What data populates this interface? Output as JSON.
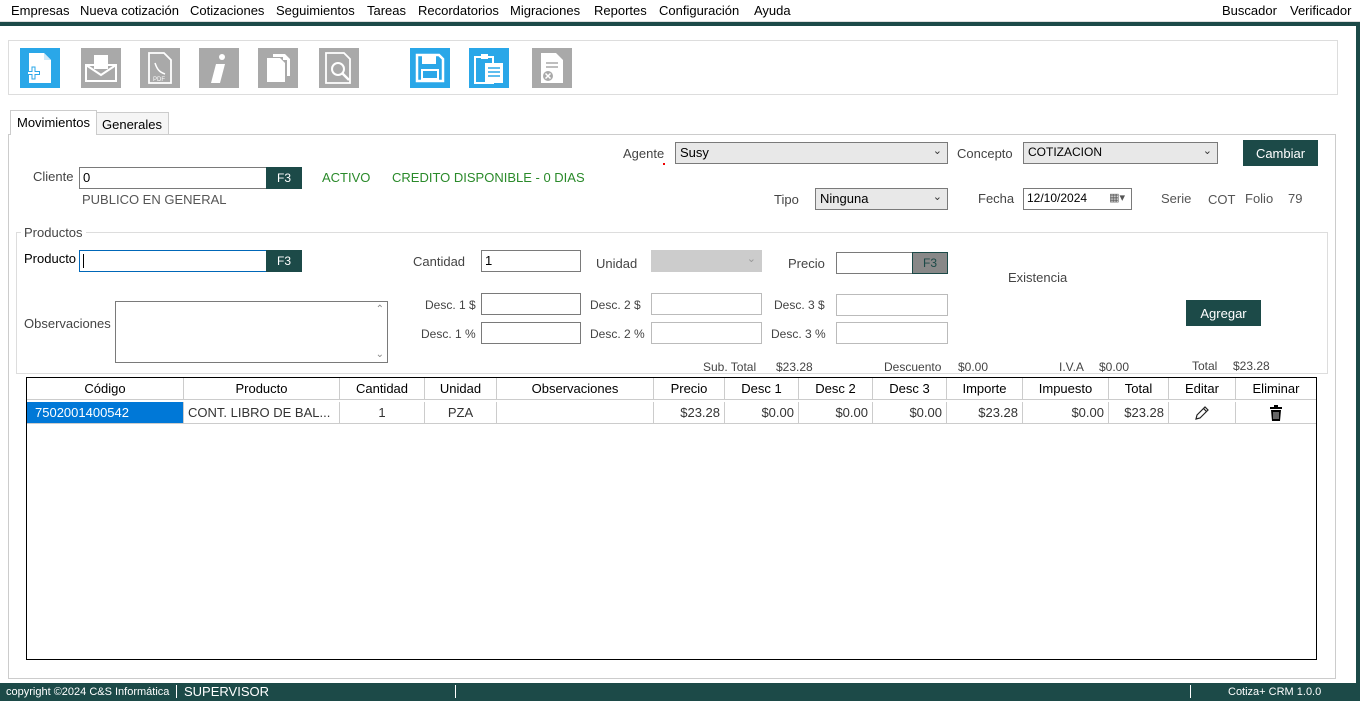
{
  "menu": [
    "Empresas",
    "Nueva cotización",
    "Cotizaciones",
    "Seguimientos",
    "Tareas",
    "Recordatorios",
    "Migraciones",
    "Reportes",
    "Configuración",
    "Ayuda"
  ],
  "menu_right": [
    "Buscador",
    "Verificador"
  ],
  "tabs": [
    "Movimientos",
    "Generales"
  ],
  "cliente": {
    "label": "Cliente",
    "value": "0",
    "f3": "F3",
    "nombre": "PUBLICO EN GENERAL",
    "estado": "ACTIVO",
    "credito": "CREDITO DISPONIBLE - 0 DIAS"
  },
  "agente": {
    "label": "Agente",
    "value": "Susy"
  },
  "concepto": {
    "label": "Concepto",
    "value": "COTIZACION"
  },
  "cambiar": "Cambiar",
  "tipo": {
    "label": "Tipo",
    "value": "Ninguna"
  },
  "fecha": {
    "label": "Fecha",
    "value": "12/10/2024"
  },
  "serie": {
    "label": "Serie",
    "value": "COT"
  },
  "folio": {
    "label": "Folio",
    "value": "79"
  },
  "productos": {
    "legend": "Productos",
    "producto_label": "Producto",
    "producto_value": "",
    "f3": "F3",
    "cantidad_label": "Cantidad",
    "cantidad_value": "1",
    "unidad_label": "Unidad",
    "precio_label": "Precio",
    "precio_f3": "F3",
    "existencia_label": "Existencia",
    "observaciones_label": "Observaciones",
    "desc1d": "Desc. 1 $",
    "desc2d": "Desc. 2 $",
    "desc3d": "Desc. 3 $",
    "desc1p": "Desc. 1 %",
    "desc2p": "Desc. 2 %",
    "desc3p": "Desc. 3 %",
    "agregar": "Agregar"
  },
  "totales": {
    "subtotal_label": "Sub. Total",
    "subtotal": "$23.28",
    "descuento_label": "Descuento",
    "descuento": "$0.00",
    "iva_label": "I.V.A",
    "iva": "$0.00",
    "total_label": "Total",
    "total": "$23.28"
  },
  "grid": {
    "headers": [
      "Código",
      "Producto",
      "Cantidad",
      "Unidad",
      "Observaciones",
      "Precio",
      "Desc 1",
      "Desc 2",
      "Desc 3",
      "Importe",
      "Impuesto",
      "Total",
      "Editar",
      "Eliminar"
    ],
    "rows": [
      [
        "7502001400542",
        "CONT. LIBRO DE BAL...",
        "1",
        "PZA",
        "",
        "$23.28",
        "$0.00",
        "$0.00",
        "$0.00",
        "$23.28",
        "$0.00",
        "$23.28"
      ]
    ]
  },
  "status": {
    "copyright": "copyright ©2024 C&S Informática",
    "user": "SUPERVISOR",
    "version": "Cotiza+ CRM 1.0.0"
  },
  "colors": {
    "accent": "#1c4a48",
    "toolbar_blue": "#2aa7e8",
    "toolbar_gray": "#a9a9a9",
    "selected_row": "#0078d7",
    "green_text": "#2a8a2a"
  },
  "toolbar_icons": [
    "new-document-icon",
    "email-icon",
    "pdf-icon",
    "info-icon",
    "copy-icon",
    "preview-icon",
    "save-icon",
    "clipboard-icon",
    "cancel-document-icon"
  ]
}
